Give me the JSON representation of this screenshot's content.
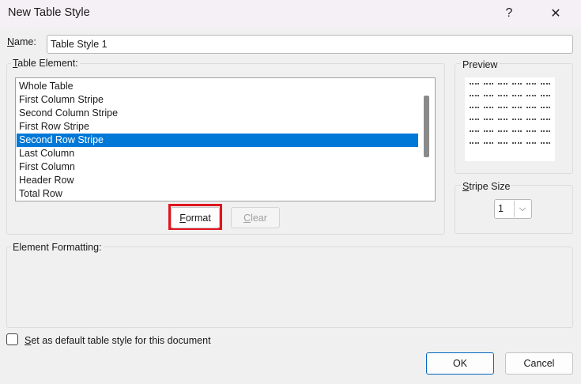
{
  "window": {
    "title": "New Table Style",
    "help_glyph": "?",
    "close_glyph": "✕"
  },
  "name_field": {
    "label": "Name:",
    "value": "Table Style 1"
  },
  "table_element": {
    "label": "Table Element:",
    "items": [
      {
        "label": "Whole Table",
        "selected": false
      },
      {
        "label": "First Column Stripe",
        "selected": false
      },
      {
        "label": "Second Column Stripe",
        "selected": false
      },
      {
        "label": "First Row Stripe",
        "selected": false
      },
      {
        "label": "Second Row Stripe",
        "selected": true
      },
      {
        "label": "Last Column",
        "selected": false
      },
      {
        "label": "First Column",
        "selected": false
      },
      {
        "label": "Header Row",
        "selected": false
      },
      {
        "label": "Total Row",
        "selected": false
      }
    ],
    "format_button": "Format",
    "clear_button": "Clear"
  },
  "preview": {
    "label": "Preview"
  },
  "stripe_size": {
    "label": "Stripe Size",
    "value": "1",
    "arrow_glyph": "⌵"
  },
  "element_formatting": {
    "label": "Element Formatting:"
  },
  "default_checkbox": {
    "label": "Set as default table style for this document",
    "checked": false
  },
  "footer": {
    "ok_label": "OK",
    "cancel_label": "Cancel"
  },
  "colors": {
    "selection": "#0078d7",
    "highlight_border": "#e0151f",
    "ok_border": "#0067c0"
  }
}
